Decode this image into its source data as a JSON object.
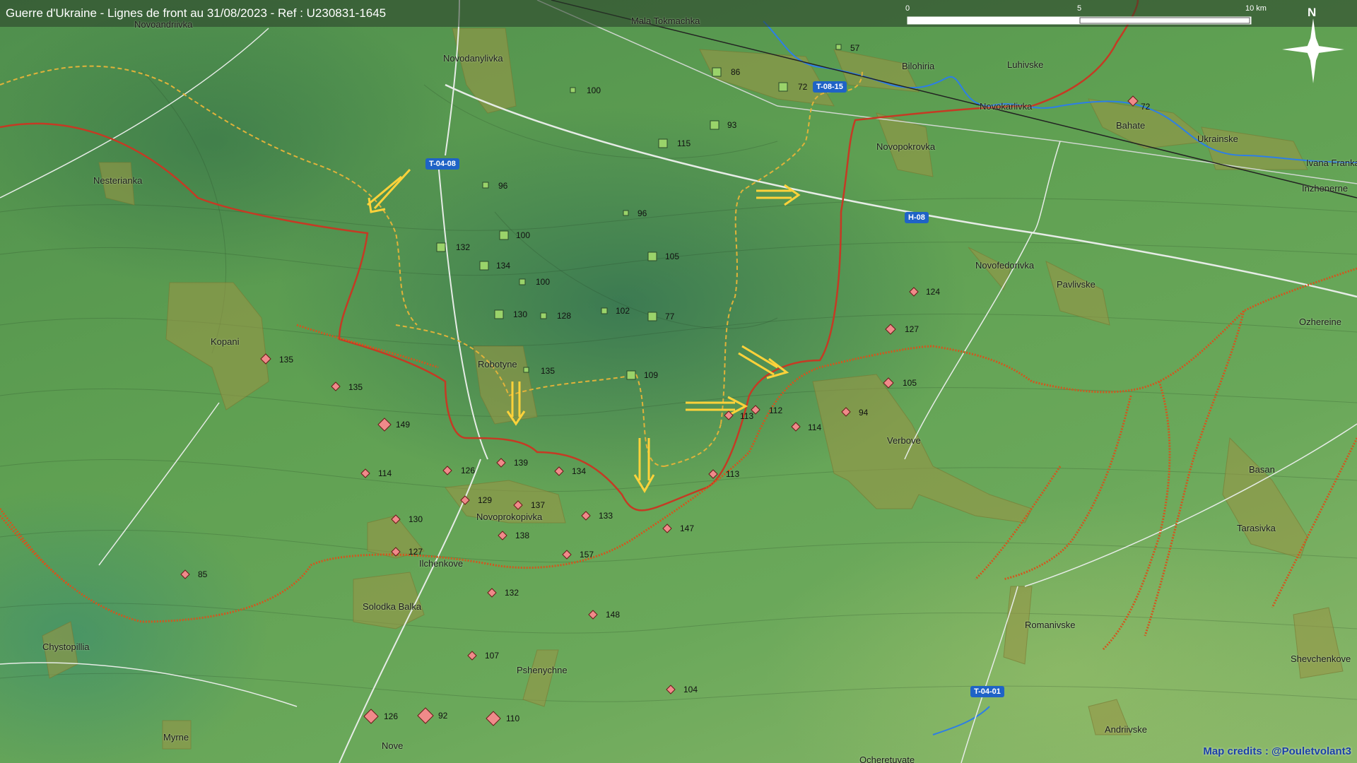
{
  "title": "Guerre d'Ukraine - Lignes de front au 31/08/2023 - Ref : U230831-1645",
  "credits": "Map credits : @Pouletvolant3",
  "scale": {
    "zero": "0",
    "mid": "5",
    "max": "10 km"
  },
  "north": "N",
  "colors": {
    "ukraine": "#9ad36a",
    "russia": "#f08a8a",
    "front_old": "#e0b23a",
    "front_new": "#c53a24",
    "arrows": "#ffd23a",
    "water": "#2d7ee6",
    "roads": "#e6ece6"
  },
  "roads": [
    "T-04-08",
    "T-08-15",
    "H-08",
    "T-04-01"
  ],
  "places": [
    "Novoandriivka",
    "Mala Tokmachka",
    "Novodanylivka",
    "Bilohiria",
    "Luhivske",
    "Novokarlivka",
    "Bahate",
    "Ukrainske",
    "Ivana Franka",
    "Inzhenerne",
    "Novopokrovka",
    "Nesterianka",
    "Novofedorivka",
    "Pavlivske",
    "Ozhereine",
    "Kopani",
    "Robotyne",
    "Verbove",
    "Basan",
    "Novoprokopivka",
    "Tarasivka",
    "Ilchenkove",
    "Solodka Balka",
    "Romanivske",
    "Chystopillia",
    "Shevchenkove",
    "Pshenychne",
    "Andriivske",
    "Myrne",
    "Nove",
    "Ocheretuvate"
  ],
  "units_ukraine": [
    "57",
    "86",
    "72",
    "100",
    "93",
    "115",
    "96",
    "96",
    "132",
    "100",
    "134",
    "105",
    "100",
    "130",
    "128",
    "102",
    "77",
    "135",
    "109"
  ],
  "units_russia": [
    "72",
    "124",
    "127",
    "135",
    "135",
    "105",
    "149",
    "112",
    "113",
    "94",
    "114",
    "114",
    "126",
    "139",
    "134",
    "113",
    "129",
    "137",
    "130",
    "133",
    "138",
    "147",
    "127",
    "157",
    "85",
    "132",
    "148",
    "107",
    "104",
    "126",
    "92",
    "110"
  ]
}
